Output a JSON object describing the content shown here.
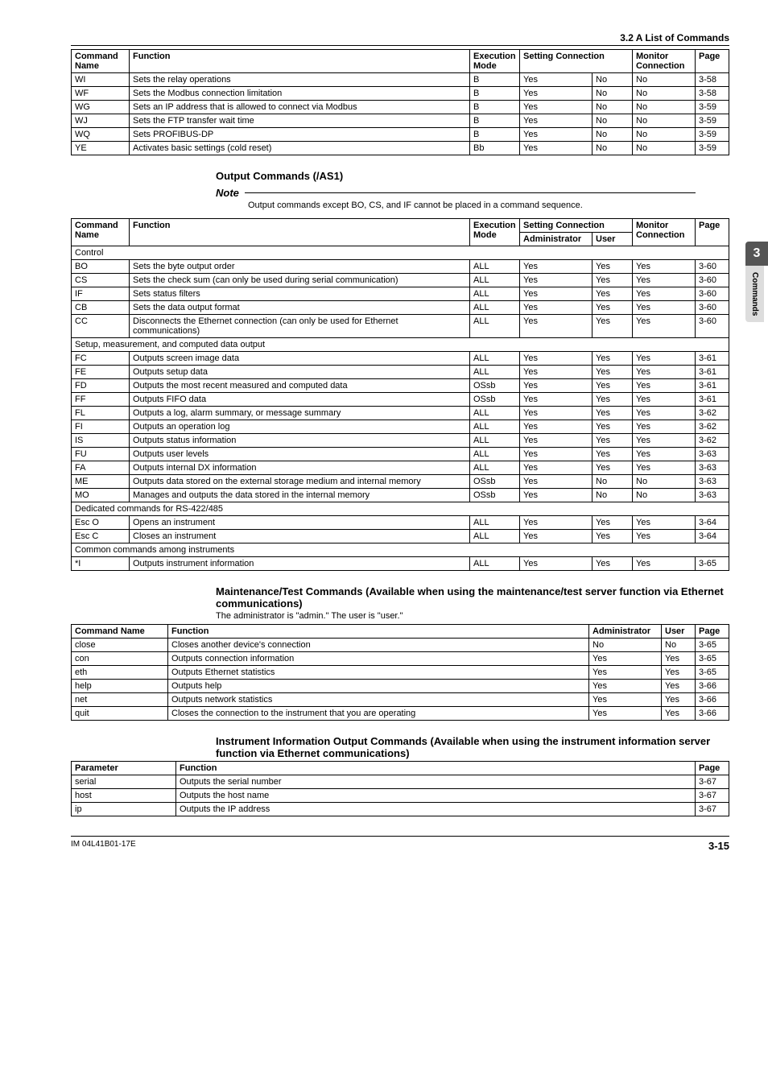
{
  "header": {
    "section": "3.2  A List of Commands"
  },
  "sideTab": {
    "chapter": "3",
    "label": "Commands"
  },
  "footer": {
    "doc": "IM 04L41B01-17E",
    "page": "3-15"
  },
  "table1": {
    "head": {
      "cmd": "Command Name",
      "func": "Function",
      "mode": "Execution Mode",
      "setconn": "Setting Connection",
      "mon": "Monitor Connection",
      "page": "Page"
    },
    "rows": [
      {
        "cmd": "WI",
        "func": "Sets the relay operations",
        "mode": "B",
        "s1": "Yes",
        "s2": "No",
        "mon": "No",
        "page": "3-58"
      },
      {
        "cmd": "WF",
        "func": "Sets the Modbus connection limitation",
        "mode": "B",
        "s1": "Yes",
        "s2": "No",
        "mon": "No",
        "page": "3-58"
      },
      {
        "cmd": "WG",
        "func": "Sets an IP address that is allowed to connect via Modbus",
        "mode": "B",
        "s1": "Yes",
        "s2": "No",
        "mon": "No",
        "page": "3-59"
      },
      {
        "cmd": "WJ",
        "func": "Sets the FTP transfer wait time",
        "mode": "B",
        "s1": "Yes",
        "s2": "No",
        "mon": "No",
        "page": "3-59"
      },
      {
        "cmd": "WQ",
        "func": "Sets PROFIBUS-DP",
        "mode": "B",
        "s1": "Yes",
        "s2": "No",
        "mon": "No",
        "page": "3-59"
      },
      {
        "cmd": "YE",
        "func": "Activates basic settings (cold reset)",
        "mode": "Bb",
        "s1": "Yes",
        "s2": "No",
        "mon": "No",
        "page": "3-59"
      }
    ]
  },
  "outputTitle": "Output Commands (/AS1)",
  "note": {
    "label": "Note",
    "text": "Output commands except BO, CS, and IF cannot be placed in a command sequence."
  },
  "table2": {
    "head": {
      "cmd": "Command Name",
      "func": "Function",
      "mode": "Execution Mode",
      "setconn": "Setting Connection",
      "admin": "Administrator",
      "user": "User",
      "mon": "Monitor Connection",
      "page": "Page"
    },
    "groups": [
      {
        "label": "Control",
        "rows": [
          {
            "cmd": "BO",
            "func": "Sets the byte output order",
            "mode": "ALL",
            "a": "Yes",
            "u": "Yes",
            "m": "Yes",
            "p": "3-60"
          },
          {
            "cmd": "CS",
            "func": "Sets the check sum (can only be used during serial communication)",
            "mode": "ALL",
            "a": "Yes",
            "u": "Yes",
            "m": "Yes",
            "p": "3-60"
          },
          {
            "cmd": "IF",
            "func": "Sets status filters",
            "mode": "ALL",
            "a": "Yes",
            "u": "Yes",
            "m": "Yes",
            "p": "3-60"
          },
          {
            "cmd": "CB",
            "func": "Sets the data output format",
            "mode": "ALL",
            "a": "Yes",
            "u": "Yes",
            "m": "Yes",
            "p": "3-60"
          },
          {
            "cmd": "CC",
            "func": "Disconnects the Ethernet connection (can only be used for Ethernet communications)",
            "mode": "ALL",
            "a": "Yes",
            "u": "Yes",
            "m": "Yes",
            "p": "3-60"
          }
        ]
      },
      {
        "label": "Setup, measurement, and computed data output",
        "rows": [
          {
            "cmd": "FC",
            "func": "Outputs screen image data",
            "mode": "ALL",
            "a": "Yes",
            "u": "Yes",
            "m": "Yes",
            "p": "3-61"
          },
          {
            "cmd": "FE",
            "func": "Outputs setup data",
            "mode": "ALL",
            "a": "Yes",
            "u": "Yes",
            "m": "Yes",
            "p": "3-61"
          },
          {
            "cmd": "FD",
            "func": "Outputs the most recent measured and computed data",
            "mode": "OSsb",
            "a": "Yes",
            "u": "Yes",
            "m": "Yes",
            "p": "3-61"
          },
          {
            "cmd": "FF",
            "func": "Outputs FIFO data",
            "mode": "OSsb",
            "a": "Yes",
            "u": "Yes",
            "m": "Yes",
            "p": "3-61"
          },
          {
            "cmd": "FL",
            "func": "Outputs a log, alarm summary, or message summary",
            "mode": "ALL",
            "a": "Yes",
            "u": "Yes",
            "m": "Yes",
            "p": "3-62"
          },
          {
            "cmd": "FI",
            "func": "Outputs an operation log",
            "mode": "ALL",
            "a": "Yes",
            "u": "Yes",
            "m": "Yes",
            "p": "3-62"
          },
          {
            "cmd": "IS",
            "func": "Outputs status information",
            "mode": "ALL",
            "a": "Yes",
            "u": "Yes",
            "m": "Yes",
            "p": "3-62"
          },
          {
            "cmd": "FU",
            "func": "Outputs user levels",
            "mode": "ALL",
            "a": "Yes",
            "u": "Yes",
            "m": "Yes",
            "p": "3-63"
          },
          {
            "cmd": "FA",
            "func": "Outputs internal DX information",
            "mode": "ALL",
            "a": "Yes",
            "u": "Yes",
            "m": "Yes",
            "p": "3-63"
          },
          {
            "cmd": "ME",
            "func": "Outputs data stored on the external storage medium and internal memory",
            "mode": "OSsb",
            "a": "Yes",
            "u": "No",
            "m": "No",
            "p": "3-63"
          },
          {
            "cmd": "MO",
            "func": "Manages and outputs the data stored in the internal memory",
            "mode": "OSsb",
            "a": "Yes",
            "u": "No",
            "m": "No",
            "p": "3-63"
          }
        ]
      },
      {
        "label": "Dedicated commands for RS-422/485",
        "rows": [
          {
            "cmd": "Esc O",
            "func": "Opens an instrument",
            "mode": "ALL",
            "a": "Yes",
            "u": "Yes",
            "m": "Yes",
            "p": "3-64"
          },
          {
            "cmd": "Esc C",
            "func": "Closes an instrument",
            "mode": "ALL",
            "a": "Yes",
            "u": "Yes",
            "m": "Yes",
            "p": "3-64"
          }
        ]
      },
      {
        "label": "Common commands among instruments",
        "rows": [
          {
            "cmd": "*I",
            "func": "Outputs instrument information",
            "mode": "ALL",
            "a": "Yes",
            "u": "Yes",
            "m": "Yes",
            "p": "3-65"
          }
        ]
      }
    ]
  },
  "maint": {
    "title": "Maintenance/Test Commands (Available when using the maintenance/test server function via Ethernet communications)",
    "sub": "The administrator is \"admin.\" The user is \"user.\"",
    "head": {
      "name": "Command Name",
      "func": "Function",
      "admin": "Administrator",
      "user": "User",
      "page": "Page"
    },
    "rows": [
      {
        "n": "close",
        "f": "Closes another device's connection",
        "a": "No",
        "u": "No",
        "p": "3-65"
      },
      {
        "n": "con",
        "f": "Outputs connection information",
        "a": "Yes",
        "u": "Yes",
        "p": "3-65"
      },
      {
        "n": "eth",
        "f": "Outputs Ethernet statistics",
        "a": "Yes",
        "u": "Yes",
        "p": "3-65"
      },
      {
        "n": "help",
        "f": "Outputs help",
        "a": "Yes",
        "u": "Yes",
        "p": "3-66"
      },
      {
        "n": "net",
        "f": "Outputs network statistics",
        "a": "Yes",
        "u": "Yes",
        "p": "3-66"
      },
      {
        "n": "quit",
        "f": "Closes the connection to the instrument that you are operating",
        "a": "Yes",
        "u": "Yes",
        "p": "3-66"
      }
    ]
  },
  "instr": {
    "title": "Instrument Information Output Commands (Available when using the instrument information server function via Ethernet communications)",
    "head": {
      "param": "Parameter",
      "func": "Function",
      "page": "Page"
    },
    "rows": [
      {
        "n": "serial",
        "f": "Outputs the serial number",
        "p": "3-67"
      },
      {
        "n": "host",
        "f": "Outputs the host name",
        "p": "3-67"
      },
      {
        "n": "ip",
        "f": "Outputs the IP address",
        "p": "3-67"
      }
    ]
  }
}
